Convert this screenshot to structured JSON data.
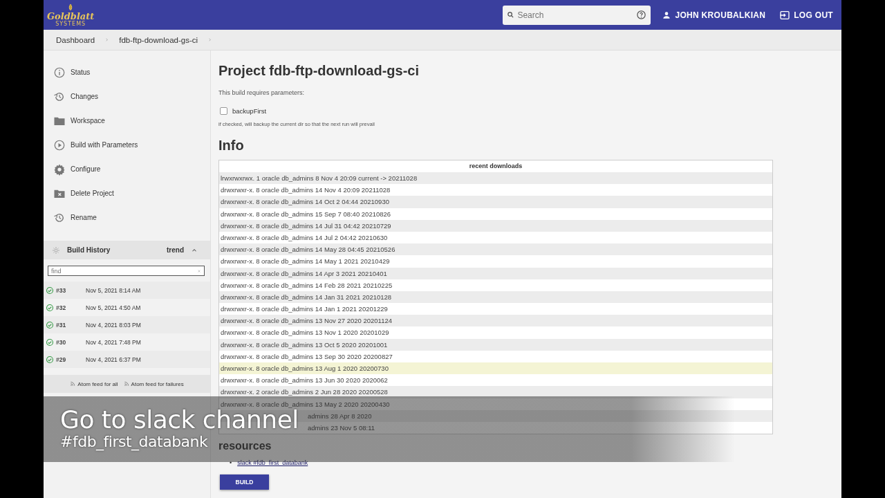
{
  "header": {
    "logo": "Goldblatt",
    "logo_sub": "SYSTEMS",
    "search": {
      "placeholder": "Search"
    },
    "user": "JOHN KROUBALKIAN",
    "logout": "LOG OUT"
  },
  "breadcrumbs": [
    "Dashboard",
    "fdb-ftp-download-gs-ci"
  ],
  "sidebar": {
    "items": [
      "Status",
      "Changes",
      "Workspace",
      "Build with Parameters",
      "Configure",
      "Delete Project",
      "Rename"
    ],
    "build_history": {
      "title": "Build History",
      "trend": "trend",
      "expanded": true,
      "find": {
        "placeholder": "find"
      },
      "builds": [
        {
          "number": "#33",
          "date": "Nov 5, 2021 8:14 AM"
        },
        {
          "number": "#32",
          "date": "Nov 5, 2021 4:50 AM"
        },
        {
          "number": "#31",
          "date": "Nov 4, 2021 8:03 PM"
        },
        {
          "number": "#30",
          "date": "Nov 4, 2021 7:48 PM"
        },
        {
          "number": "#29",
          "date": "Nov 4, 2021 6:37 PM"
        }
      ],
      "feeds": [
        "Atom feed for all",
        "Atom feed for failures"
      ]
    }
  },
  "main": {
    "title": "Project fdb-ftp-download-gs-ci",
    "params_note": "This build requires parameters:",
    "parameter": {
      "label": "backupFirst",
      "checked": false,
      "help": "if checked, will backup the current dir so that the next run will prevail"
    },
    "info_title": "Info",
    "table": {
      "heading": "recent downloads",
      "rows": [
        {
          "text": "lrwxrwxrwx. 1 oracle db_admins 8 Nov 4 20:09 current -> 20211028",
          "hovered": false
        },
        {
          "text": "drwxrwxr-x. 8 oracle db_admins 14 Nov 4 20:09 20211028",
          "hovered": false
        },
        {
          "text": "drwxrwxr-x. 8 oracle db_admins 14 Oct 2 04:44 20210930",
          "hovered": false
        },
        {
          "text": "drwxrwxr-x. 8 oracle db_admins 15 Sep 7 08:40 20210826",
          "hovered": false
        },
        {
          "text": "drwxrwxr-x. 8 oracle db_admins 14 Jul 31 04:42 20210729",
          "hovered": false
        },
        {
          "text": "drwxrwxr-x. 8 oracle db_admins 14 Jul 2 04:42 20210630",
          "hovered": false
        },
        {
          "text": "drwxrwxr-x. 8 oracle db_admins 14 May 28 04:45 20210526",
          "hovered": false
        },
        {
          "text": "drwxrwxr-x. 8 oracle db_admins 14 May 1 2021 20210429",
          "hovered": false
        },
        {
          "text": "drwxrwxr-x. 8 oracle db_admins 14 Apr 3 2021 20210401",
          "hovered": false
        },
        {
          "text": "drwxrwxr-x. 8 oracle db_admins 14 Feb 28 2021 20210225",
          "hovered": false
        },
        {
          "text": "drwxrwxr-x. 8 oracle db_admins 14 Jan 31 2021 20210128",
          "hovered": false
        },
        {
          "text": "drwxrwxr-x. 8 oracle db_admins 14 Jan 1 2021 20201229",
          "hovered": false
        },
        {
          "text": "drwxrwxr-x. 8 oracle db_admins 13 Nov 27 2020 20201124",
          "hovered": false
        },
        {
          "text": "drwxrwxr-x. 8 oracle db_admins 13 Nov 1 2020 20201029",
          "hovered": false
        },
        {
          "text": "drwxrwxr-x. 8 oracle db_admins 13 Oct 5 2020 20201001",
          "hovered": false
        },
        {
          "text": "drwxrwxr-x. 8 oracle db_admins 13 Sep 30 2020 20200827",
          "hovered": false
        },
        {
          "text": "drwxrwxr-x. 8 oracle db_admins 13 Aug 1 2020 20200730",
          "hovered": true
        },
        {
          "text": "drwxrwxr-x. 8 oracle db_admins 13 Jun 30 2020 2020062",
          "hovered": false
        },
        {
          "text": "drwxrwxr-x. 2 oracle db_admins 2 Jun 28 2020 20200528",
          "hovered": false
        },
        {
          "text": "drwxrwxr-x. 8 oracle db_admins 13 May 2 2020 20200430",
          "hovered": false
        },
        {
          "text": "admins 28 Apr 8 2020",
          "hovered": false,
          "kind": "partial"
        },
        {
          "text": "admins 23 Nov 5 08:11",
          "hovered": false,
          "kind": "partial"
        }
      ]
    },
    "resources_title": "resources",
    "links": [
      {
        "bullet": "•",
        "text": "slack #fdb_first_databank"
      }
    ],
    "build_button": "BUILD"
  },
  "caption": {
    "line1": "Go to slack channel",
    "line2": "#fdb_first_databank"
  }
}
